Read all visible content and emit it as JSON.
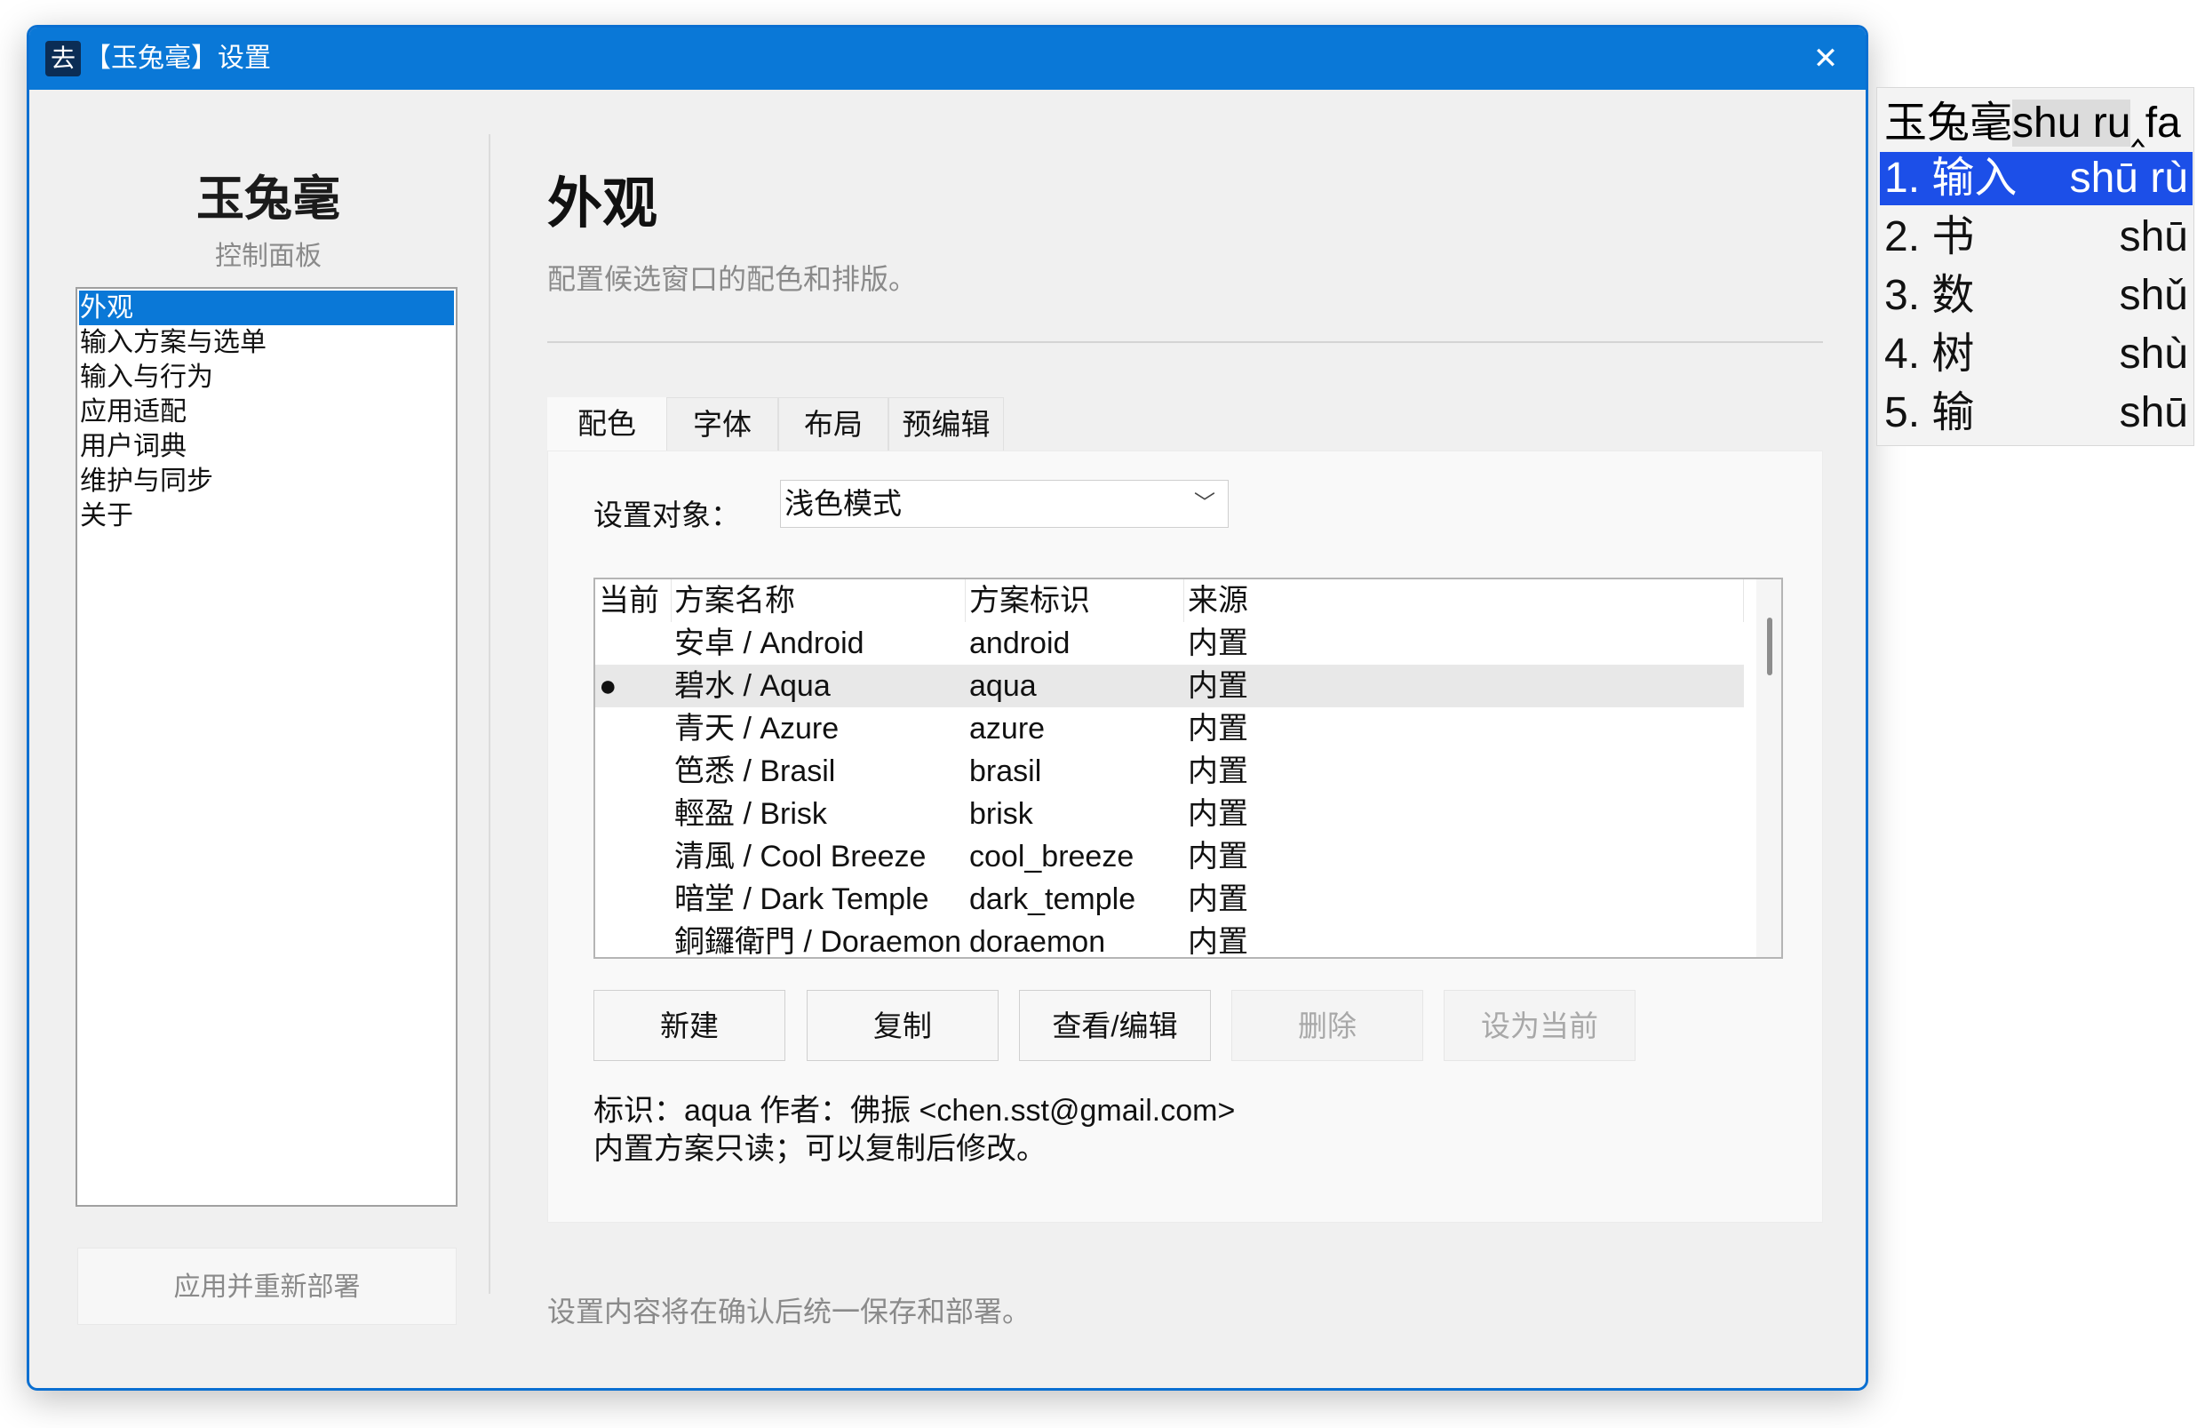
{
  "window": {
    "title": "【玉兔毫】设置",
    "app_icon": "去"
  },
  "brand": {
    "name": "玉兔毫",
    "subtitle": "控制面板"
  },
  "sidebar": {
    "items": [
      {
        "label": "外观",
        "selected": true
      },
      {
        "label": "输入方案与选单"
      },
      {
        "label": "输入与行为"
      },
      {
        "label": "应用适配"
      },
      {
        "label": "用户词典"
      },
      {
        "label": "维护与同步"
      },
      {
        "label": "关于"
      }
    ],
    "apply_label": "应用并重新部署"
  },
  "main": {
    "title": "外观",
    "description": "配置候选窗口的配色和排版。",
    "tabs": [
      {
        "label": "配色",
        "active": true
      },
      {
        "label": "字体"
      },
      {
        "label": "布局"
      },
      {
        "label": "预编辑"
      }
    ],
    "target": {
      "label": "设置对象：",
      "value": "浅色模式"
    },
    "table": {
      "headers": [
        "当前",
        "方案名称",
        "方案标识",
        "来源"
      ],
      "rows": [
        {
          "current": "",
          "name": "安卓 / Android",
          "id": "android",
          "source": "内置"
        },
        {
          "current": "●",
          "name": "碧水 / Aqua",
          "id": "aqua",
          "source": "内置"
        },
        {
          "current": "",
          "name": "青天 / Azure",
          "id": "azure",
          "source": "内置"
        },
        {
          "current": "",
          "name": "笆悉 / Brasil",
          "id": "brasil",
          "source": "内置"
        },
        {
          "current": "",
          "name": "輕盈 / Brisk",
          "id": "brisk",
          "source": "内置"
        },
        {
          "current": "",
          "name": "清風 / Cool Breeze",
          "id": "cool_breeze",
          "source": "内置"
        },
        {
          "current": "",
          "name": "暗堂 / Dark Temple",
          "id": "dark_temple",
          "source": "内置"
        },
        {
          "current": "",
          "name": "銅鑼衛門 / Doraemon",
          "id": "doraemon",
          "source": "内置"
        },
        {
          "current": "",
          "name": "",
          "id": "",
          "source": ""
        }
      ]
    },
    "buttons": {
      "new": "新建",
      "copy": "复制",
      "view_edit": "查看/编辑",
      "delete": "删除",
      "set_current": "设为当前"
    },
    "info": {
      "line1": "标识：aqua    作者：佛振 <chen.sst@gmail.com>",
      "line2": "内置方案只读；可以复制后修改。"
    },
    "footer": "设置内容将在确认后统一保存和部署。"
  },
  "candidate_popup": {
    "preedit_prefix": "玉兔毫",
    "preedit_highlight": "shu ru",
    "preedit_caret": "‸",
    "preedit_rest": "fa",
    "candidates": [
      {
        "label": "1. 输入",
        "pinyin": "shū rù",
        "selected": true
      },
      {
        "label": "2. 书",
        "pinyin": "shū"
      },
      {
        "label": "3. 数",
        "pinyin": "shǔ"
      },
      {
        "label": "4. 树",
        "pinyin": "shù"
      },
      {
        "label": "5. 输",
        "pinyin": "shū"
      }
    ]
  },
  "colors": {
    "accent": "#0a78d7",
    "candidate_highlight": "#1c4fe8",
    "window_bg": "#f0f0f0"
  }
}
